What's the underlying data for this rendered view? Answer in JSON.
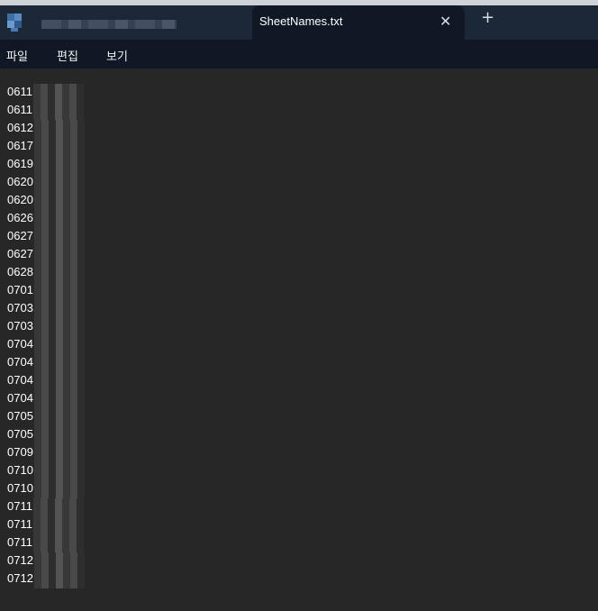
{
  "window": {
    "inactive_tab_title": "",
    "active_tab": {
      "title": "SheetNames.txt",
      "close_icon": "close-icon"
    },
    "new_tab_icon": "plus-icon"
  },
  "menu": {
    "file": "파일",
    "edit": "편집",
    "view": "보기"
  },
  "editor": {
    "lines": [
      "0611",
      "0611",
      "0612",
      "0617",
      "0619",
      "0620",
      "0620",
      "0626",
      "0627",
      "0627",
      "0628",
      "0701",
      "0703",
      "0703",
      "0704",
      "0704",
      "0704",
      "0704",
      "0705",
      "0705",
      "0709",
      "0710",
      "0710",
      "0711",
      "0711",
      "0711",
      "0712",
      "0712"
    ]
  }
}
